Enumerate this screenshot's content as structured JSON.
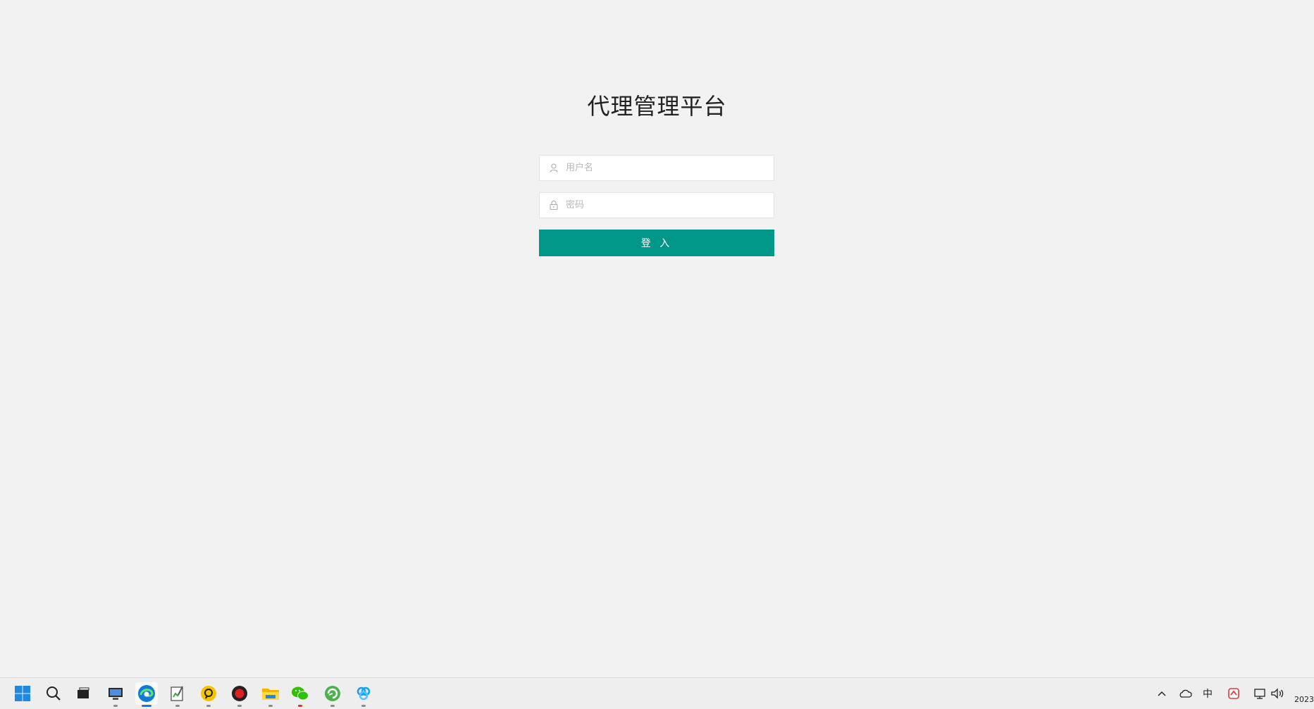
{
  "login": {
    "title": "代理管理平台",
    "username_placeholder": "用户名",
    "password_placeholder": "密码",
    "submit_label": "登 入"
  },
  "taskbar": {
    "apps": [
      {
        "name": "windows-start",
        "icon": "windows-logo-icon"
      },
      {
        "name": "search",
        "icon": "search-icon"
      },
      {
        "name": "task-view",
        "icon": "task-view-icon"
      },
      {
        "name": "remote-desktop",
        "icon": "monitor-icon"
      },
      {
        "name": "edge",
        "icon": "edge-browser-icon"
      },
      {
        "name": "notepad",
        "icon": "notepad-icon"
      },
      {
        "name": "app-yellow",
        "icon": "yellow-app-icon"
      },
      {
        "name": "recorder",
        "icon": "record-icon"
      },
      {
        "name": "file-explorer",
        "icon": "folder-icon"
      },
      {
        "name": "wechat",
        "icon": "wechat-icon"
      },
      {
        "name": "app-green",
        "icon": "green-app-icon"
      },
      {
        "name": "app-blue",
        "icon": "blue-app-icon"
      }
    ],
    "tray": {
      "ime_label": "中",
      "clock_text": "2023"
    }
  },
  "colors": {
    "background": "#f2f2f2",
    "primary_button": "#009688",
    "taskbar": "#eeeeee"
  }
}
